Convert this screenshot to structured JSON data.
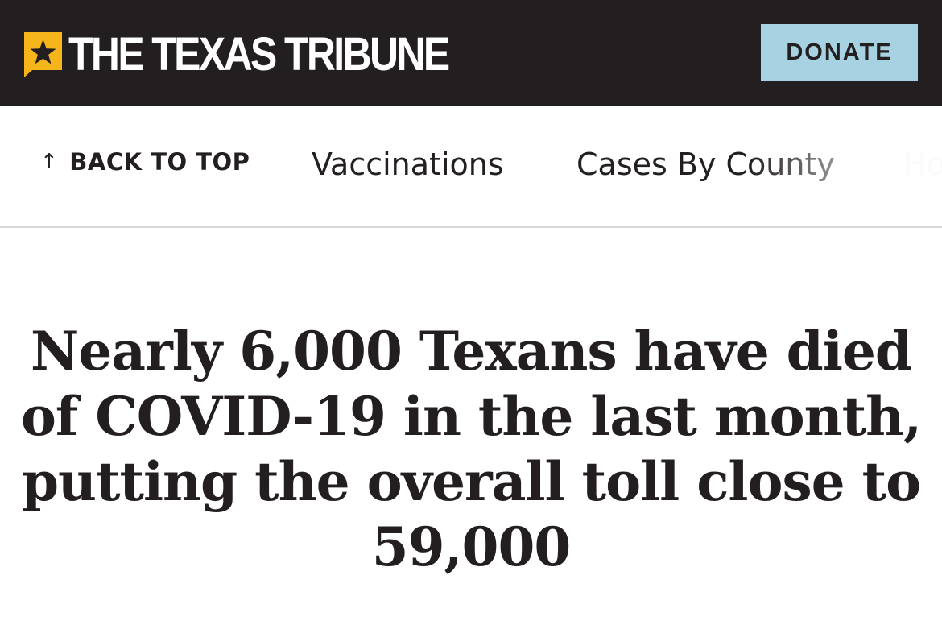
{
  "brand": {
    "name": "THE TEXAS TRIBUNE",
    "colors": {
      "header_bg": "#231f20",
      "logo_accent": "#f5b51b",
      "donate_bg": "#a7d2e2"
    }
  },
  "header": {
    "donate_label": "DONATE"
  },
  "subnav": {
    "back_to_top": "BACK TO TOP",
    "items": [
      {
        "label": "Vaccinations"
      },
      {
        "label": "Cases By County"
      },
      {
        "label": "Ho"
      }
    ]
  },
  "article": {
    "headline": "Nearly 6,000 Texans have died of COVID-19 in the last month, putting the overall toll close to 59,000"
  }
}
